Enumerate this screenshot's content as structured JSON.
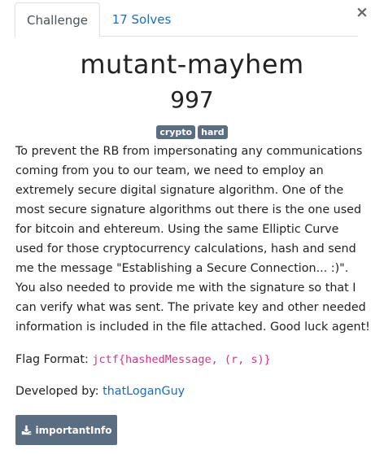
{
  "tabs": [
    {
      "label": "Challenge",
      "active": true
    },
    {
      "label": "17 Solves",
      "active": false
    }
  ],
  "close_label": "×",
  "challenge": {
    "name": "mutant-mayhem",
    "points": "997",
    "tags": [
      "crypto",
      "hard"
    ],
    "description": "To prevent the RB from impersonating any communications coming from you to our team, we need to employ an extremely secure digital signature algorithm. One of the most secure signature algorithms out there is the one used for bitcoin and ehtereum. Using the same Elliptic Curve used for those cryptocurrency calculations, hash and send me the message \"Establishing a Secure Connection... :)\". You also needed to provide me with the signature so that I can verify what was sent. The private key and other needed information is included in the file attached. Good luck agent!",
    "flag_format_label": "Flag Format:",
    "flag_format_value": "jctf{hashedMessage, (r, s)}",
    "developed_by_label": "Developed by:",
    "developer": "thatLoganGuy",
    "file_label": "importantInfo"
  },
  "colors": {
    "link": "#1f6bb5",
    "tag_bg": "#5b6d80",
    "code": "#d63384"
  },
  "icons": {
    "close": "close-icon",
    "file": "download-icon"
  }
}
